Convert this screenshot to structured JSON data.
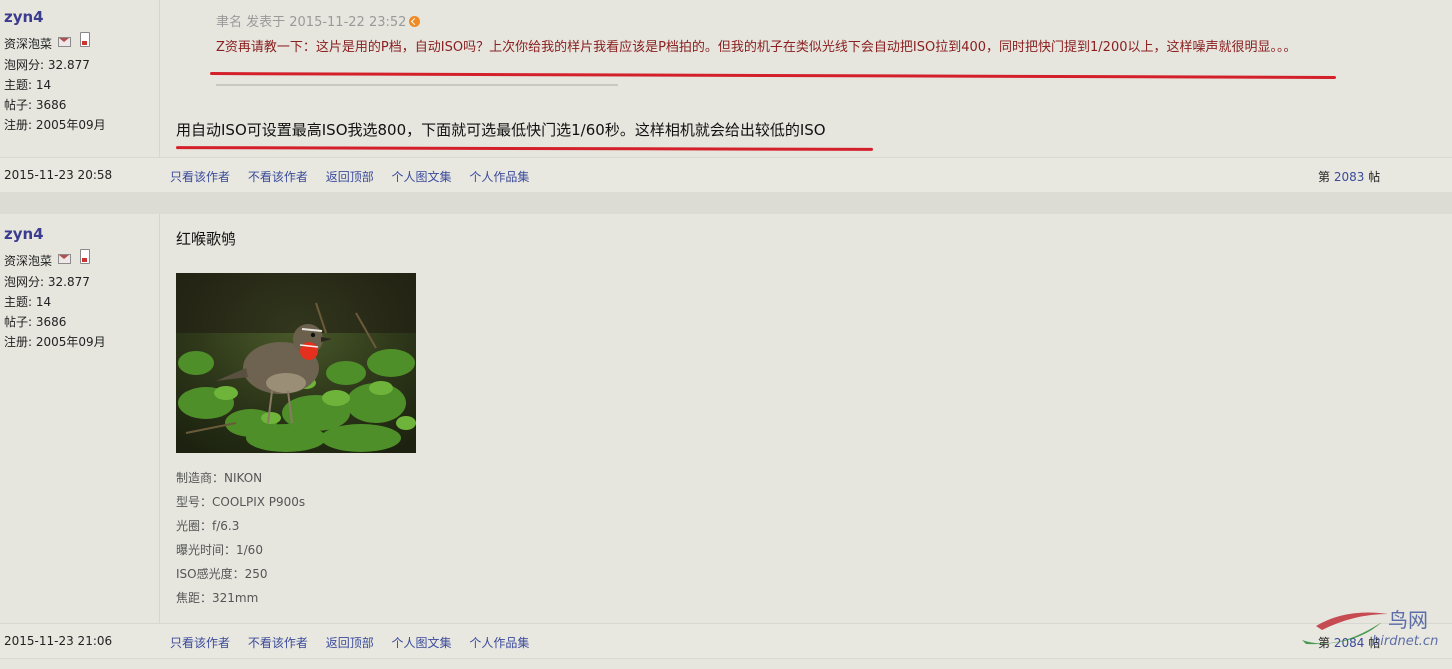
{
  "post1": {
    "author": {
      "name": "zyn4",
      "level": "资深泡菜",
      "score": "泡网分: 32.877",
      "topics": "主题: 14",
      "posts": "帖子: 3686",
      "joined": "注册: 2005年09月"
    },
    "quote_header": "聿名 发表于 2015-11-22 23:52",
    "quote_text": "Z资再请教一下：这片是用的P档，自动ISO吗？上次你给我的样片我看应该是P档拍的。但我的机子在类似光线下会自动把ISO拉到400，同时把快门提到1/200以上，这样噪声就很明显。。。",
    "body": "用自动ISO可设置最高ISO我选800，下面就可选最低快门选1/60秒。这样相机就会给出较低的ISO",
    "date": "2015-11-23 20:58",
    "floor_prefix": "第",
    "floor_num": "2083",
    "floor_suffix": "帖"
  },
  "post2": {
    "author": {
      "name": "zyn4",
      "level": "资深泡菜",
      "score": "泡网分: 32.877",
      "topics": "主题: 14",
      "posts": "帖子: 3686",
      "joined": "注册: 2005年09月"
    },
    "title": "红喉歌鸲",
    "exif": [
      "制造商：NIKON",
      "型号：COOLPIX P900s",
      "光圈：f/6.3",
      "曝光时间：1/60",
      "ISO感光度：250",
      "焦距：321mm"
    ],
    "date": "2015-11-23 21:06",
    "floor_prefix": "第",
    "floor_num": "2084",
    "floor_suffix": "帖"
  },
  "actions": [
    "只看该作者",
    "不看该作者",
    "返回顶部",
    "个人图文集",
    "个人作品集"
  ],
  "watermark": {
    "title": "鸟网",
    "sub": "birdnet.cn"
  },
  "colors": {
    "highlight_line": "#d4202a",
    "link": "#3b4a9a",
    "quote": "#8a2020"
  }
}
